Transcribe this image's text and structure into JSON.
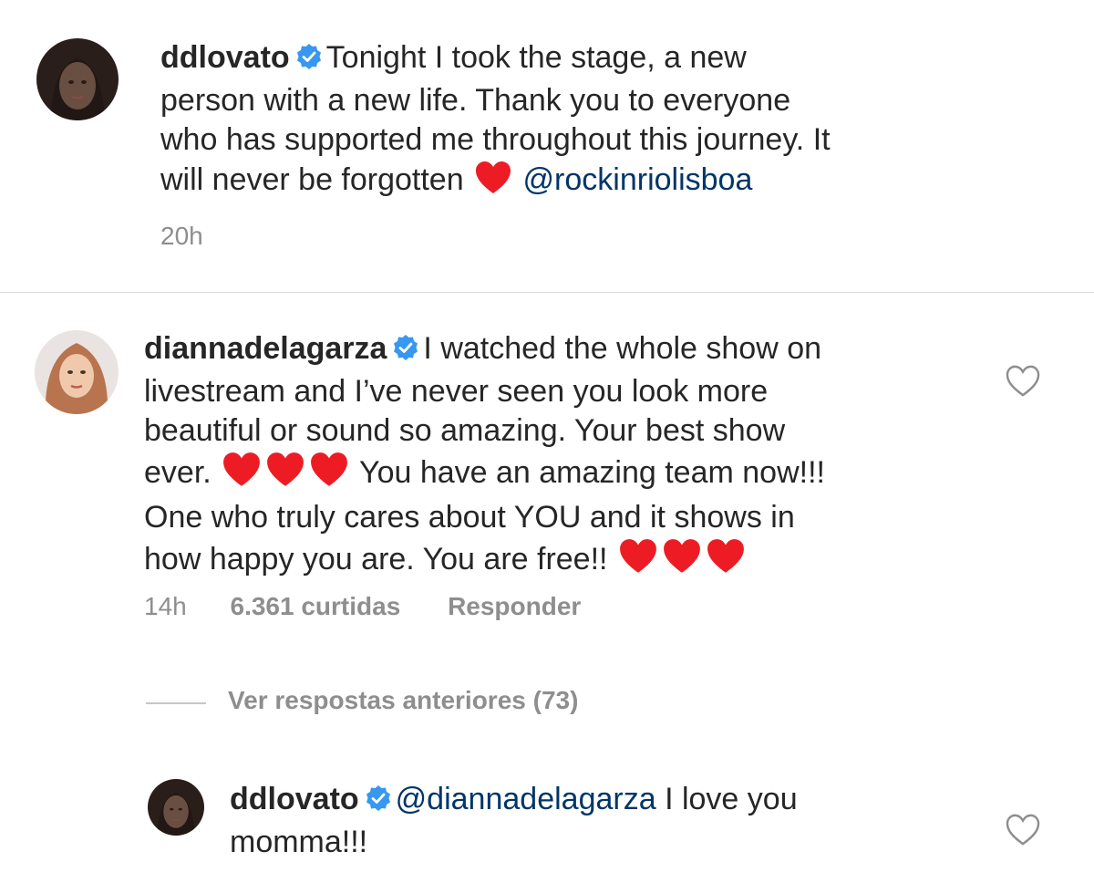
{
  "post": {
    "username": "ddlovato",
    "text_line1": "Tonight I took the stage, a new",
    "text_line2": "person with a new life. Thank you to everyone",
    "text_line3": "who has supported me throughout this journey. It",
    "text_line4": "will never be forgotten",
    "mention": "@rockinriolisboa",
    "time": "20h",
    "avatar_icon": "profile-photo-dark-hair"
  },
  "comment": {
    "username": "diannadelagarza",
    "line1": "I watched the whole show on",
    "line2": "livestream and I’ve never seen you look more",
    "line3": "beautiful or sound so amazing. Your best show",
    "line4a": "ever.",
    "line4b": "You have an amazing team now!!!",
    "line5": "One who truly cares about YOU and it shows in",
    "line6": "how happy you are.  You are free!!",
    "time": "14h",
    "likes": "6.361 curtidas",
    "reply_label": "Responder",
    "avatar_icon": "profile-photo-blonde-hair"
  },
  "view_replies": {
    "label": "Ver respostas anteriores (73)"
  },
  "reply": {
    "username": "ddlovato",
    "mention": "@diannadelagarza",
    "text_line1": "I love you",
    "text_line2": "momma!!!",
    "avatar_icon": "profile-photo-dark-hair"
  },
  "colors": {
    "text": "#262626",
    "muted": "#8e8e8e",
    "mention": "#003569",
    "verified": "#3897f0",
    "heart": "#ed1c24",
    "divider": "#dbdbdb"
  }
}
